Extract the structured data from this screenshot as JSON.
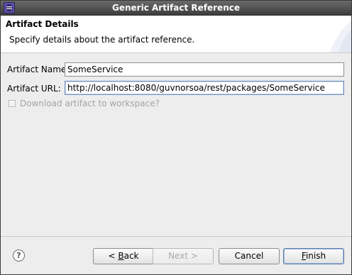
{
  "window": {
    "title": "Generic Artifact Reference"
  },
  "header": {
    "title": "Artifact Details",
    "description": "Specify details about the artifact reference."
  },
  "form": {
    "name_label": "Artifact Name:",
    "name_value": "SomeService",
    "url_label": "Artifact URL:",
    "url_value": "http://localhost:8080/guvnorsoa/rest/packages/SomeService",
    "download_label": "Download artifact to workspace?",
    "download_checked": false
  },
  "buttons": {
    "help_label": "?",
    "back_mnemonic": "B",
    "back_rest": "ack",
    "back_prefix": "< ",
    "next_label": "Next >",
    "cancel_label": "Cancel",
    "finish_mnemonic": "F",
    "finish_rest": "inish"
  },
  "icons": {
    "window_icon": "eclipse-icon",
    "help": "help-icon"
  }
}
